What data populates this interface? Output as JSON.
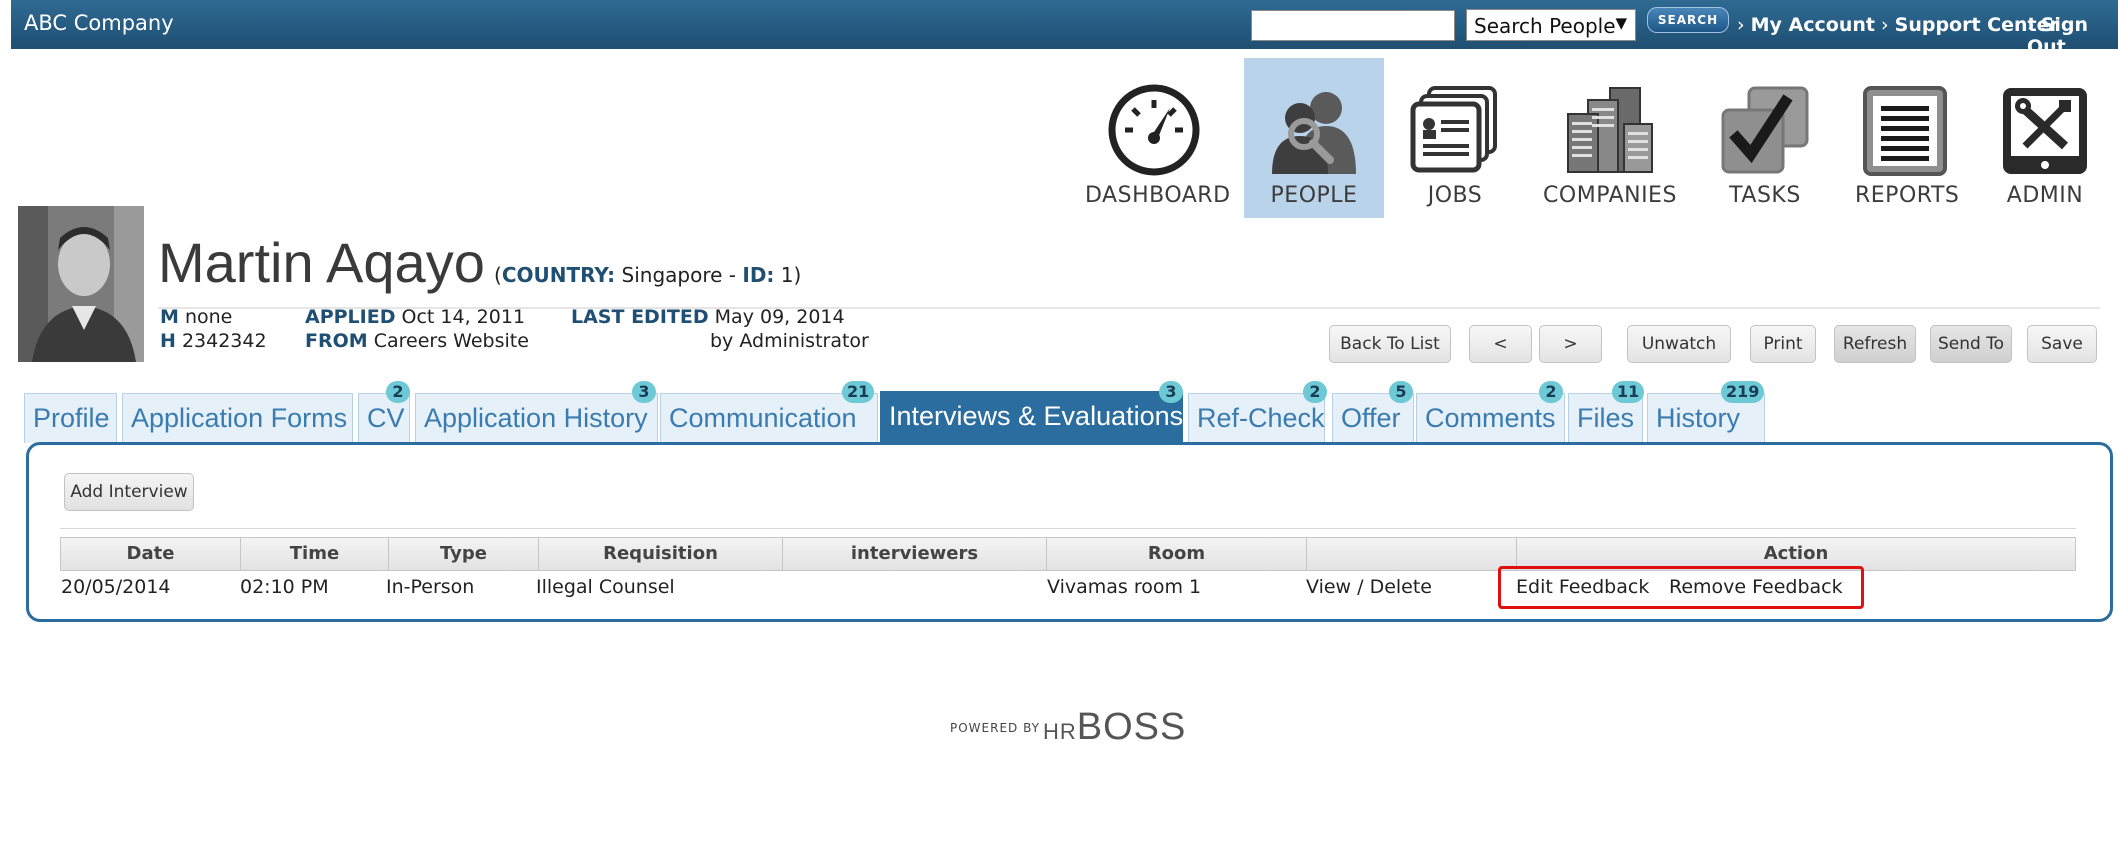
{
  "topbar": {
    "company": "ABC Company",
    "search_value": "",
    "search_scope": "Search People",
    "search_button": "SEARCH",
    "links": [
      "My Account",
      "Support Center",
      "Sign Out"
    ]
  },
  "nav": [
    {
      "label": "DASHBOARD",
      "icon": "dashboard-gauge-icon",
      "active": false
    },
    {
      "label": "PEOPLE",
      "icon": "people-icon",
      "active": true
    },
    {
      "label": "JOBS",
      "icon": "jobs-icon",
      "active": false
    },
    {
      "label": "COMPANIES",
      "icon": "companies-icon",
      "active": false
    },
    {
      "label": "TASKS",
      "icon": "tasks-icon",
      "active": false
    },
    {
      "label": "REPORTS",
      "icon": "reports-icon",
      "active": false
    },
    {
      "label": "ADMIN",
      "icon": "admin-tools-icon",
      "active": false
    }
  ],
  "candidate": {
    "name": "Martin Aqayo",
    "country_label": "COUNTRY:",
    "country": "Singapore",
    "id_label": "ID:",
    "id": "1",
    "m_label": "M",
    "m_value": "none",
    "h_label": "H",
    "h_value": "2342342",
    "applied_label": "APPLIED",
    "applied_value": "Oct 14, 2011",
    "from_label": "FROM",
    "from_value": "Careers Website",
    "last_edited_label": "LAST EDITED",
    "last_edited_value": "May 09, 2014",
    "edited_by": "by Administrator"
  },
  "actions": [
    "Back To List",
    "<",
    ">",
    "Unwatch",
    "Print",
    "Refresh",
    "Send To",
    "Save"
  ],
  "tabs": [
    {
      "label": "Profile",
      "badge": ""
    },
    {
      "label": "Application Forms",
      "badge": ""
    },
    {
      "label": "CV",
      "badge": "2"
    },
    {
      "label": "Application History",
      "badge": "3"
    },
    {
      "label": "Communication",
      "badge": "21"
    },
    {
      "label": "Interviews & Evaluations",
      "badge": "3"
    },
    {
      "label": "Ref-Check",
      "badge": "2"
    },
    {
      "label": "Offer",
      "badge": "5"
    },
    {
      "label": "Comments",
      "badge": "2"
    },
    {
      "label": "Files",
      "badge": "11"
    },
    {
      "label": "History",
      "badge": "219"
    }
  ],
  "active_tab": "Interviews & Evaluations",
  "interviews": {
    "add_button": "Add Interview",
    "columns": [
      "Date",
      "Time",
      "Type",
      "Requisition",
      "interviewers",
      "Room",
      "",
      "Action"
    ],
    "rows": [
      {
        "date": "20/05/2014",
        "time": "02:10 PM",
        "type": "In-Person",
        "requisition": "Illegal Counsel",
        "interviewers": "",
        "room": "Vivamas room 1",
        "view_delete": "View / Delete",
        "edit_feedback": "Edit Feedback",
        "remove_feedback": "Remove Feedback"
      }
    ]
  },
  "footer": {
    "powered_by": "POWERED BY",
    "brand_prefix": "HR",
    "brand": "BOSS"
  },
  "colors": {
    "topbar": "#1f4f72",
    "accent": "#2b6d9f",
    "tab_bg": "#e6f0f9",
    "badge": "#6cc9d5",
    "highlight": "#e01010"
  }
}
